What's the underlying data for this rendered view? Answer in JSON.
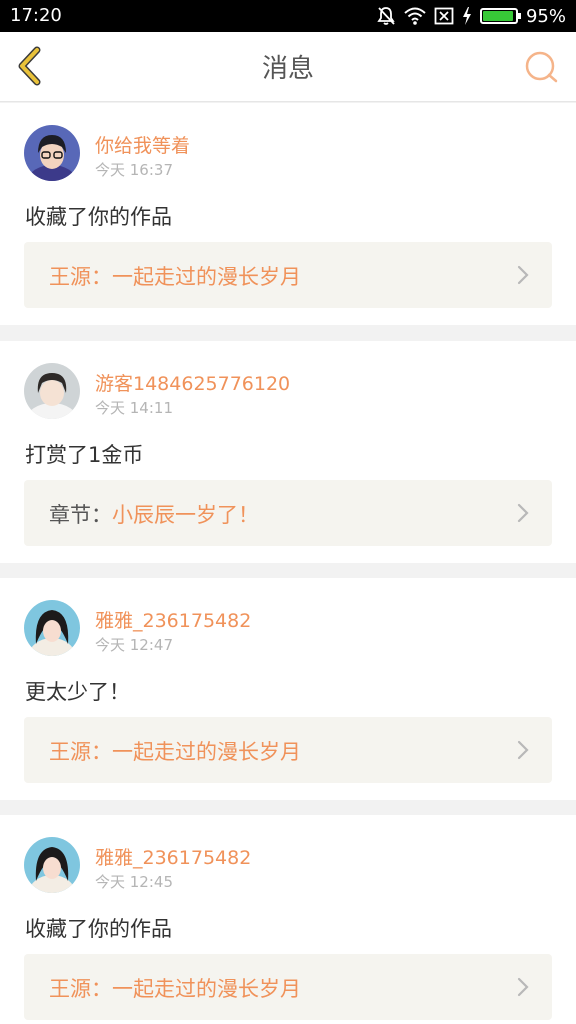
{
  "status_bar": {
    "time": "17:20",
    "battery_text": "95%",
    "battery_level": 0.95
  },
  "header": {
    "title": "消息",
    "back_icon": "chevron-left-icon",
    "search_icon": "search-icon"
  },
  "colors": {
    "accent": "#f0925a",
    "back_icon": "#e9c23a",
    "time_text": "#b5b5b5",
    "link_bg": "#f5f4ef"
  },
  "messages": [
    {
      "username": "你给我等着",
      "time": "今天 16:37",
      "action": "收藏了你的作品",
      "link_prefix": "",
      "link_text": "王源：一起走过的漫长岁月"
    },
    {
      "username": "游客1484625776120",
      "time": "今天 14:11",
      "action": "打赏了1金币",
      "link_prefix": "章节：",
      "link_text": "小辰辰一岁了！"
    },
    {
      "username": "雅雅_236175482",
      "time": "今天 12:47",
      "action": "更太少了！",
      "link_prefix": "",
      "link_text": "王源：一起走过的漫长岁月"
    },
    {
      "username": "雅雅_236175482",
      "time": "今天 12:45",
      "action": "收藏了你的作品",
      "link_prefix": "",
      "link_text": "王源：一起走过的漫长岁月"
    }
  ]
}
